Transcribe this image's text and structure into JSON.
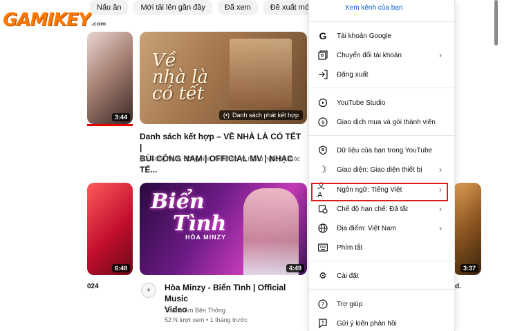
{
  "logo": {
    "text": "GAMIKEY",
    "suffix": ".com"
  },
  "chips": [
    "Nấu ăn",
    "Mới tải lên gần đây",
    "Đã xem",
    "Đề xuất mới"
  ],
  "videos": {
    "left1": {
      "duration": "3:44"
    },
    "main1": {
      "thumb_text": "Về nhà là có tết",
      "badge": "Danh sách phát kết hợp",
      "title_line1": "Danh sách kết hợp – VỀ NHÀ LÀ CÓ TẾT |",
      "title_line2": "BÙI CÔNG NAM | OFFICIAL MV | NHẠC TẾ...",
      "meta": "Bùi Công Nam, Đông Nhi, JustaTee và nhiều nghệ sĩ khác"
    },
    "left2": {
      "duration": "6:48",
      "partial_title": "024"
    },
    "main2": {
      "thumb_text1": "Biển",
      "thumb_text2": "Tình",
      "thumb_small": "HÒA MINZY",
      "duration": "4:49",
      "title_line1": "Hòa Minzy - Biển Tình | Official Music",
      "title_line2": "Video",
      "channel": "Thanh Âm Bên Thông",
      "stats": "52 N lượt xem • 1 tháng trước"
    },
    "right2": {
      "duration": "3:37",
      "partial_title": "d."
    }
  },
  "menu": {
    "top_link": "Xem kênh của bạn",
    "items": [
      {
        "label": "Tài khoản Google",
        "icon": "google-icon",
        "chevron": false
      },
      {
        "label": "Chuyển đổi tài khoản",
        "icon": "switch-account-icon",
        "chevron": true
      },
      {
        "label": "Đăng xuất",
        "icon": "sign-out-icon",
        "chevron": false
      },
      {
        "label": "YouTube Studio",
        "icon": "studio-icon",
        "chevron": false
      },
      {
        "label": "Giao dịch mua và gói thành viên",
        "icon": "dollar-icon",
        "chevron": false
      },
      {
        "label": "Dữ liệu của bạn trong YouTube",
        "icon": "data-shield-icon",
        "chevron": false
      },
      {
        "label": "Giao diện: Giao diện thiết bị",
        "icon": "moon-icon",
        "chevron": true
      },
      {
        "label": "Ngôn ngữ: Tiếng Việt",
        "icon": "translate-icon",
        "chevron": true
      },
      {
        "label": "Chế độ hạn chế: Đã tắt",
        "icon": "restricted-icon",
        "chevron": true
      },
      {
        "label": "Địa điểm: Việt Nam",
        "icon": "globe-icon",
        "chevron": true
      },
      {
        "label": "Phím tắt",
        "icon": "keyboard-icon",
        "chevron": false
      },
      {
        "label": "Cài đặt",
        "icon": "gear-icon",
        "chevron": false
      },
      {
        "label": "Trợ giúp",
        "icon": "help-icon",
        "chevron": false
      },
      {
        "label": "Gửi ý kiến phản hồi",
        "icon": "feedback-icon",
        "chevron": false
      }
    ]
  },
  "colors": {
    "link": "#065fd4",
    "highlight": "#e01b1b",
    "logo": "#ff7a00"
  }
}
